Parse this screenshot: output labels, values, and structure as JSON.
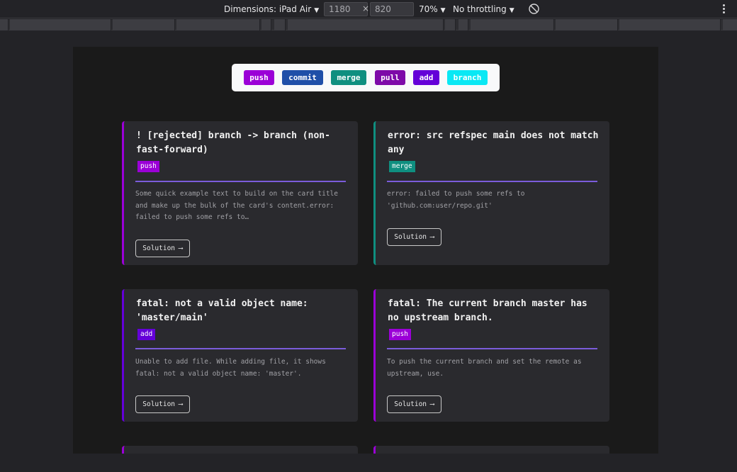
{
  "toolbar": {
    "dimensions_label": "Dimensions: iPad Air",
    "width_value": "1180",
    "times_sign": "×",
    "height_value": "820",
    "zoom": "70%",
    "throttling": "No throttling",
    "caret": "▼"
  },
  "filters": [
    {
      "label": "push",
      "color": "#9b00d7"
    },
    {
      "label": "commit",
      "color": "#1f4fa8"
    },
    {
      "label": "merge",
      "color": "#0f8f80"
    },
    {
      "label": "pull",
      "color": "#7d0aa8"
    },
    {
      "label": "add",
      "color": "#6400d8"
    },
    {
      "label": "branch",
      "color": "#0ae8f4"
    }
  ],
  "cards": [
    {
      "title": "! [rejected] branch -> branch (non-fast-forward)",
      "tag": "push",
      "tag_color": "#9b00d7",
      "border_color": "#9b00d7",
      "text": "Some quick example text to build on the card title and make up the bulk of the card's content.error: failed to push some refs to…",
      "button": "Solution",
      "arrow": "⟶"
    },
    {
      "title": "error: src refspec main does not match any",
      "tag": "merge",
      "tag_color": "#0f8f80",
      "border_color": "#0f8f80",
      "text": "error: failed to push some refs to 'github.com:user/repo.git'",
      "button": "Solution",
      "arrow": "⟶"
    },
    {
      "title": "fatal: not a valid object name: 'master/main'",
      "tag": "add",
      "tag_color": "#6400d8",
      "border_color": "#6400d8",
      "text": "Unable to add file. While adding file, it shows fatal: not a valid object name: 'master'.",
      "button": "Solution",
      "arrow": "⟶"
    },
    {
      "title": "fatal: The current branch master has no upstream branch.",
      "tag": "push",
      "tag_color": "#9b00d7",
      "border_color": "#9b00d7",
      "text": "To push the current branch and set the remote as upstream, use.",
      "button": "Solution",
      "arrow": "⟶"
    }
  ],
  "colors": {
    "page_bg": "#1a1a1a",
    "card_bg": "#2a2a2e",
    "divider": "#7b5cdb"
  }
}
